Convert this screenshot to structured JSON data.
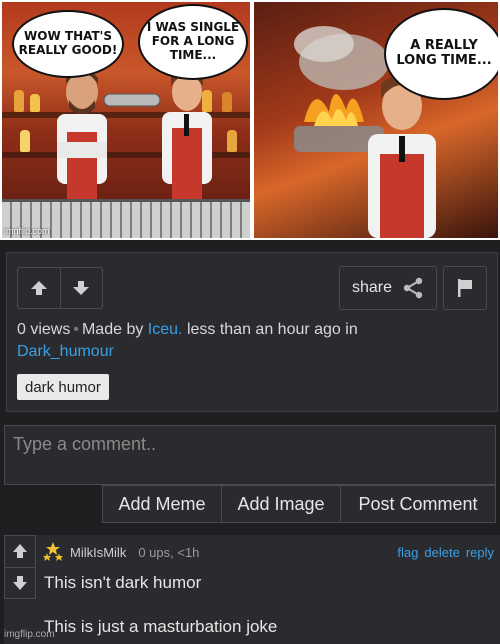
{
  "comic": {
    "bubble1": "WOW THAT'S REALLY GOOD!",
    "bubble2": "I WAS SINGLE FOR A LONG TIME...",
    "bubble3": "A REALLY LONG TIME...",
    "watermark_left": "imgflip.com"
  },
  "post": {
    "share_label": "share",
    "views": "0 views",
    "made_by_label": "Made by",
    "author": "Iceu.",
    "time_text": "less than an hour ago in",
    "stream": "Dark_humour",
    "tag": "dark humor"
  },
  "comment_box": {
    "placeholder": "Type a comment..",
    "buttons": [
      "Add Meme",
      "Add Image",
      "Post Comment"
    ]
  },
  "comment": {
    "username": "MilkIsMilk",
    "meta": "0 ups, <1h",
    "actions": [
      "flag",
      "delete",
      "reply"
    ],
    "line1": "This isn't dark humor",
    "line2": "This is just a masturbation joke"
  },
  "watermark_bottom": "imgflip.com",
  "colors": {
    "link": "#3aa0e6",
    "panel_bg": "#2a2b2e",
    "page_bg": "#1e1f21"
  }
}
